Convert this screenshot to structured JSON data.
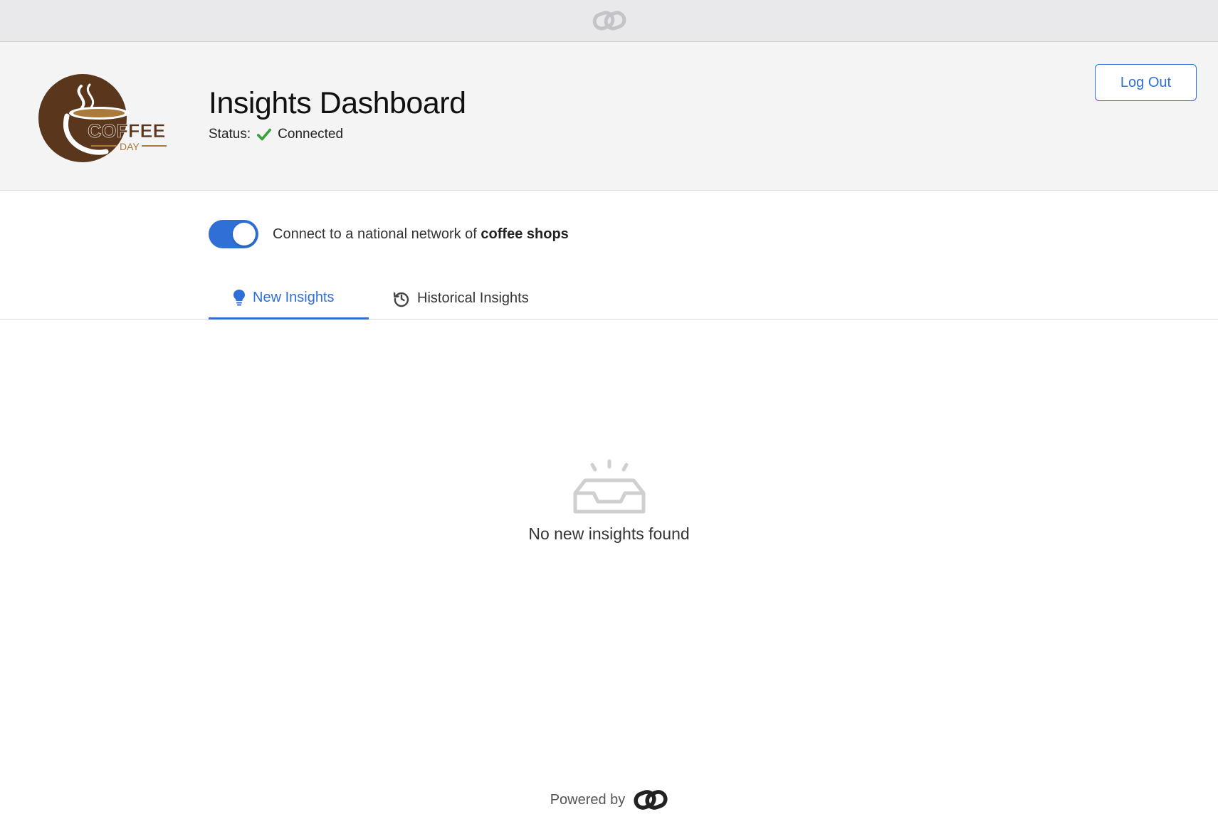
{
  "topbar": {
    "logo_icon": "chain-link-logo-icon"
  },
  "header": {
    "logo_text_main": "COFFEE",
    "logo_text_sub": "DAY",
    "title": "Insights Dashboard",
    "status_label": "Status:",
    "status_value": "Connected",
    "logout_label": "Log Out"
  },
  "network": {
    "toggle_on": true,
    "label_prefix": "Connect to a national network of",
    "label_bold": "coffee shops"
  },
  "tabs": [
    {
      "label": "New Insights",
      "icon": "lightbulb-icon",
      "active": true
    },
    {
      "label": "Historical Insights",
      "icon": "history-icon",
      "active": false
    }
  ],
  "empty_state": {
    "icon": "empty-inbox-icon",
    "message": "No new insights found"
  },
  "footer": {
    "powered_by": "Powered by",
    "logo_icon": "chain-link-logo-icon"
  },
  "colors": {
    "accent": "#2f6fd6",
    "success": "#3aa13a",
    "coffee_brown": "#5a361c",
    "coffee_gold": "#a97a3a"
  }
}
